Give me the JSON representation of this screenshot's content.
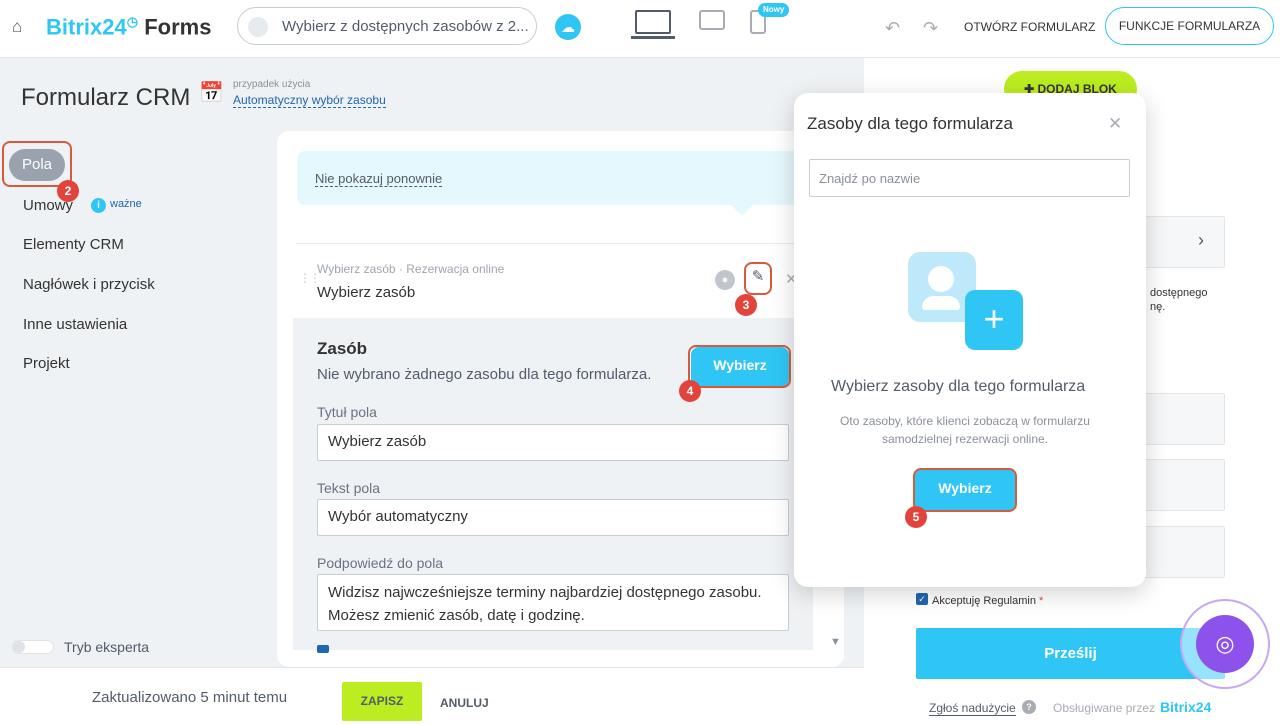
{
  "header": {
    "logo_text": "Bitrix24",
    "logo_suffix": "Forms",
    "resource_select": "Wybierz z dostępnych zasobów z 2...",
    "new_badge": "Nowy",
    "open_form": "OTWÓRZ FORMULARZ",
    "form_functions": "FUNKCJE FORMULARZA"
  },
  "left": {
    "title": "Formularz CRM",
    "usecase_label": "przypadek użycia",
    "usecase_value": "Automatyczny wybór zasobu",
    "nav": [
      "Pola",
      "Umowy",
      "Elementy CRM",
      "Nagłówek i przycisk",
      "Inne ustawienia",
      "Projekt"
    ],
    "important": "ważne",
    "expert_mode": "Tryb eksperta"
  },
  "steps": [
    "2",
    "3",
    "4",
    "5"
  ],
  "editor": {
    "notice": "Nie pokazuj ponownie",
    "field_subtitle": "Wybierz zasób · Rezerwacja online",
    "field_name": "Wybierz zasób",
    "section_title": "Zasób",
    "section_desc": "Nie wybrano żadnego zasobu dla tego formularza.",
    "choose_button": "Wybierz",
    "title_label": "Tytuł pola",
    "title_value": "Wybierz zasób",
    "text_label": "Tekst pola",
    "text_value": "Wybór automatyczny",
    "hint_label": "Podpowiedź do pola",
    "hint_value": "Widzisz najwcześniejsze terminy najbardziej dostępnego zasobu. Możesz zmienić zasób, datę i godzinę."
  },
  "footer": {
    "updated": "Zaktualizowano 5 minut temu",
    "save": "ZAPISZ",
    "cancel": "ANULUJ"
  },
  "preview": {
    "add_block": "DODAJ BLOK",
    "side_text": "dostępnego\nnę.",
    "accept": "Akceptuję Regulamin",
    "submit": "Prześlij",
    "abuse": "Zgłoś nadużycie",
    "powered": "Obsługiwane przez",
    "brand": "Bitrix24"
  },
  "popup": {
    "title": "Zasoby dla tego formularza",
    "search_placeholder": "Znajdź po nazwie",
    "heading": "Wybierz zasoby dla tego formularza",
    "desc": "Oto zasoby, które klienci zobaczą w formularzu samodzielnej rezerwacji online.",
    "button": "Wybierz"
  }
}
